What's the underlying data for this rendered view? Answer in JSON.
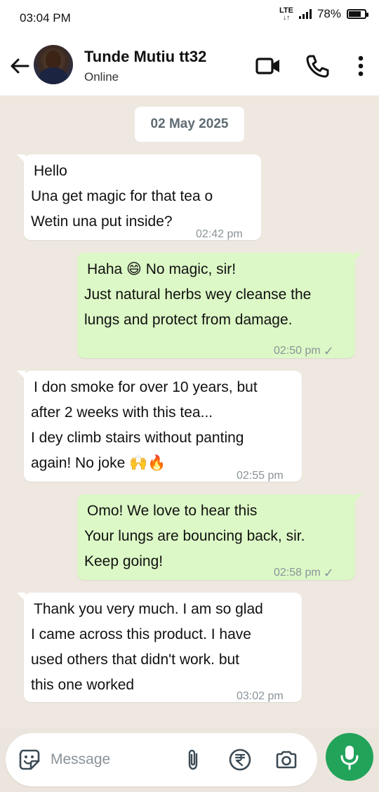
{
  "status_bar": {
    "time": "03:04 PM",
    "network": "LTE",
    "battery": "78%",
    "battery_level": 0.78
  },
  "header": {
    "contact_name": "Tunde Mutiu tt32",
    "contact_status": "Online",
    "icons": [
      "back-arrow-icon",
      "video-call-icon",
      "phone-icon",
      "more-vert-icon"
    ]
  },
  "date_separator": "02 May 2025",
  "messages": [
    {
      "direction": "in",
      "lines": [
        "Hello",
        "Una get magic for that tea o",
        "Wetin una put inside?"
      ],
      "time": "02:42 pm"
    },
    {
      "direction": "out",
      "lines": [
        "Haha 😄 No magic, sir!",
        "Just natural herbs wey cleanse the",
        "lungs and protect from damage."
      ],
      "time": "02:50 pm",
      "tick": "✓"
    },
    {
      "direction": "in",
      "lines": [
        "I don smoke for over 10 years, but",
        "after 2 weeks with this tea...",
        "I dey climb stairs without panting",
        "again! No joke 🙌🔥"
      ],
      "time": "02:55 pm"
    },
    {
      "direction": "out",
      "lines": [
        "Omo! We love to hear this",
        "Your lungs are bouncing back, sir.",
        "Keep going!"
      ],
      "time": "02:58 pm",
      "tick": "✓"
    },
    {
      "direction": "in",
      "lines": [
        "Thank you very much. I am so glad",
        "I came across this product. I have",
        "used others that didn't work. but",
        "this one worked"
      ],
      "time": "03:02 pm"
    }
  ],
  "composer": {
    "placeholder": "Message",
    "icons": [
      "sticker-icon",
      "attach-icon",
      "rupee-payment-icon",
      "camera-icon",
      "mic-icon"
    ]
  },
  "colors": {
    "incoming_bubble": "#FFFFFF",
    "outgoing_bubble": "#DCF8C6",
    "chat_background": "#EEE8E0",
    "mic_button": "#21A35A"
  }
}
